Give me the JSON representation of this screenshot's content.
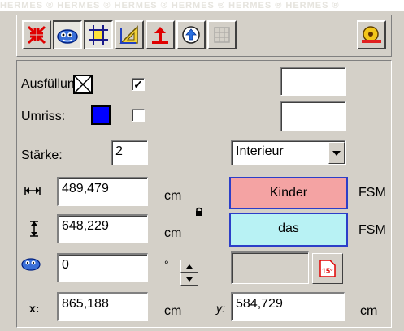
{
  "watermark": "HERMES ® HERMES ® HERMES ® HERMES ® HERMES ® HERMES ®",
  "toolbar": {
    "buttons": [
      {
        "icon": "shrink-arrows-icon"
      },
      {
        "icon": "eye-view-icon"
      },
      {
        "icon": "grid-select-icon"
      },
      {
        "icon": "triangle-ruler-icon"
      },
      {
        "icon": "arrow-up-baseline-icon"
      },
      {
        "icon": "circle-up-arrow-icon"
      },
      {
        "icon": "grid-table-icon"
      },
      {
        "icon": "tape-measure-icon"
      }
    ]
  },
  "fill": {
    "label": "Ausfüllung",
    "checkbox_checked": true,
    "checkbox_mark": "✓"
  },
  "outline": {
    "label": "Umriss:",
    "swatch_color": "#0000ff",
    "checkbox_checked": false
  },
  "thickness": {
    "label": "Stärke:",
    "value": "2"
  },
  "position_mode": {
    "selected": "Interieur"
  },
  "width": {
    "value": "489,479",
    "unit": "cm"
  },
  "height": {
    "value": "648,229",
    "unit": "cm"
  },
  "font_boxes": [
    {
      "text": "Kinder",
      "background": "#f4a3a3",
      "suffix": "FSM"
    },
    {
      "text": "das",
      "background": "#b8f2f4",
      "suffix": "FSM"
    }
  ],
  "rotation": {
    "value": "0",
    "unit": "°"
  },
  "x": {
    "label": "x:",
    "value": "865,188",
    "unit": "cm"
  },
  "y": {
    "label": "y:",
    "value": "584,729",
    "unit": "cm"
  },
  "colors": {
    "face": "#d4d0c8",
    "accent_red": "#e00000",
    "border_blue": "#2c3ec8"
  }
}
